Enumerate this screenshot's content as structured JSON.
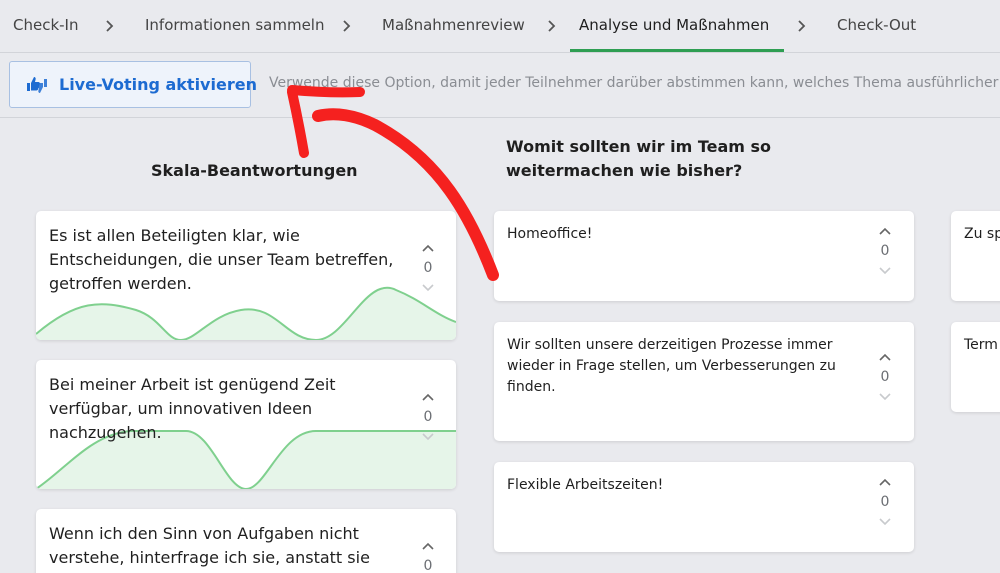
{
  "stepper": {
    "steps": [
      {
        "label": "Check-In"
      },
      {
        "label": "Informationen sammeln"
      },
      {
        "label": "Maßnahmenreview"
      },
      {
        "label": "Analyse und Maßnahmen"
      },
      {
        "label": "Check-Out"
      }
    ],
    "active_index": 3
  },
  "toolbar": {
    "voting_button_label": "Live-Voting aktivieren",
    "voting_button_icon": "thumbs-vote-icon",
    "hint": "Verwende diese Option, damit jeder Teilnehmer darüber abstimmen kann, welches Thema ausführlicher disku"
  },
  "columns": {
    "scale": {
      "heading": "Skala-Beantwortungen",
      "cards": [
        {
          "text": "Es ist allen Beteiligten klar, wie Entscheidungen, die unser Team betreffen, getroffen werden.",
          "votes": "0"
        },
        {
          "text": "Bei meiner Arbeit ist genügend Zeit verfügbar, um innovativen Ideen nachzugehen.",
          "votes": "0"
        },
        {
          "text": "Wenn ich den Sinn von Aufgaben nicht verstehe, hinterfrage ich sie, anstatt sie",
          "votes": "0"
        }
      ]
    },
    "continue": {
      "heading": "Womit sollten wir im Team so weitermachen wie bisher?",
      "cards": [
        {
          "text": "Homeoffice!",
          "votes": "0"
        },
        {
          "text": "Wir sollten unsere derzeitigen Prozesse immer wieder in Frage stellen, um Verbesserungen zu finden.",
          "votes": "0"
        },
        {
          "text": "Flexible Arbeitszeiten!",
          "votes": "0"
        }
      ]
    },
    "third": {
      "cards": [
        {
          "text": "Zu sp"
        },
        {
          "text": "Term"
        }
      ]
    }
  },
  "colors": {
    "accent_blue": "#1d6bd1",
    "active_green": "#2e9e52",
    "wave_green": "#7fd08e",
    "annotation_red": "#f5211f"
  }
}
